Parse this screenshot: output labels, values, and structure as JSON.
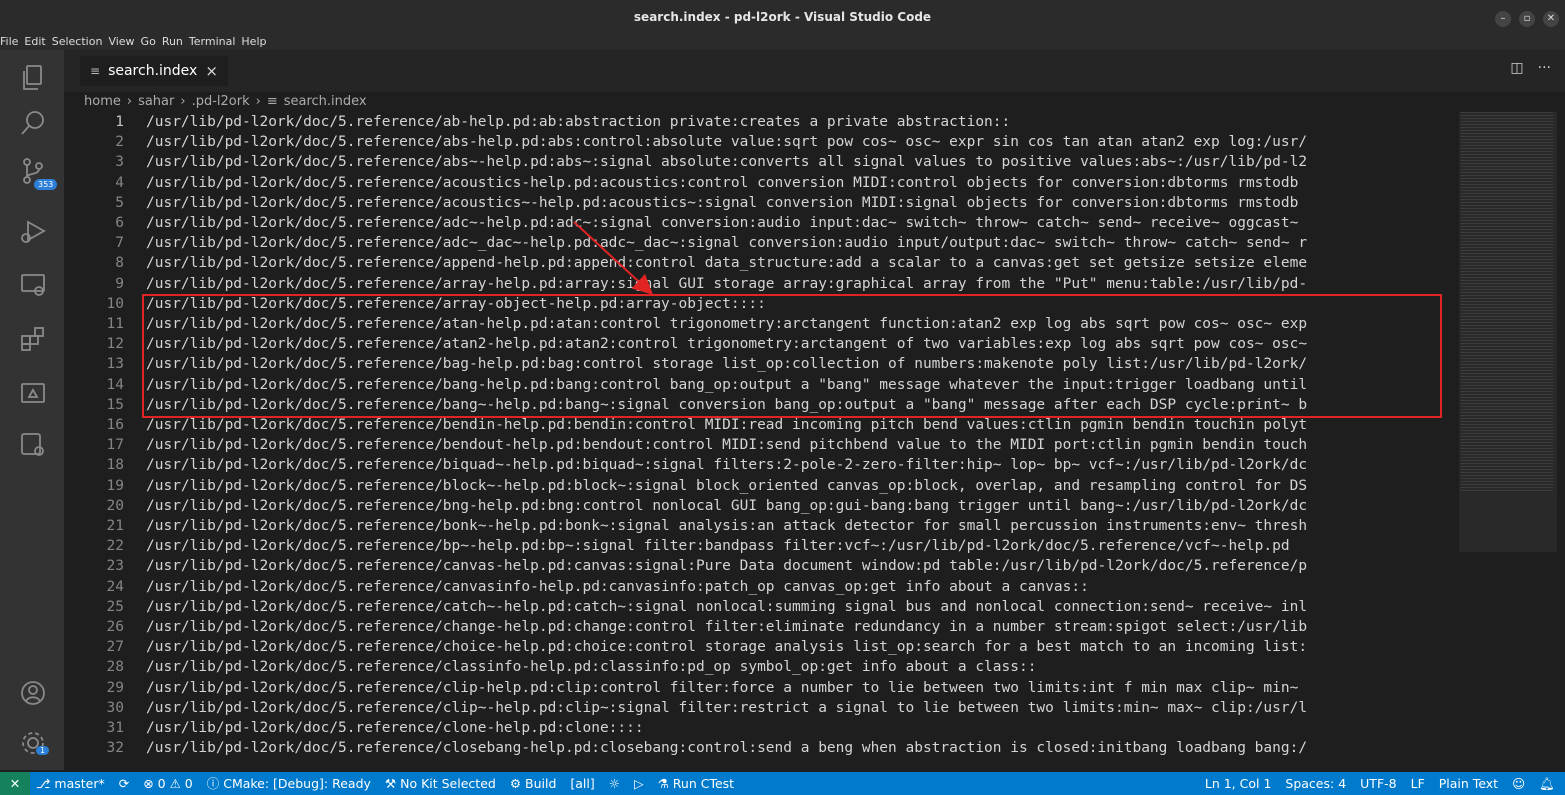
{
  "window": {
    "title": "search.index - pd-l2ork - Visual Studio Code"
  },
  "menu": [
    "File",
    "Edit",
    "Selection",
    "View",
    "Go",
    "Run",
    "Terminal",
    "Help"
  ],
  "activity_bar": {
    "scm_badge": "353",
    "manage_badge": "1"
  },
  "tab": {
    "label": "search.index",
    "close": "×"
  },
  "breadcrumb": [
    "home",
    "sahar",
    ".pd-l2ork",
    "search.index"
  ],
  "editor": {
    "lines": [
      {
        "n": "1",
        "text": "/usr/lib/pd-l2ork/doc/5.reference/ab-help.pd:ab:abstraction private:creates a private abstraction::"
      },
      {
        "n": "2",
        "text": "/usr/lib/pd-l2ork/doc/5.reference/abs-help.pd:abs:control:absolute value:sqrt pow cos~ osc~ expr sin cos tan atan atan2 exp log:/usr/"
      },
      {
        "n": "3",
        "text": "/usr/lib/pd-l2ork/doc/5.reference/abs~-help.pd:abs~:signal absolute:converts all signal values to positive values:abs~:/usr/lib/pd-l2"
      },
      {
        "n": "4",
        "text": "/usr/lib/pd-l2ork/doc/5.reference/acoustics-help.pd:acoustics:control conversion MIDI:control objects for conversion:dbtorms rmstodb"
      },
      {
        "n": "5",
        "text": "/usr/lib/pd-l2ork/doc/5.reference/acoustics~-help.pd:acoustics~:signal conversion MIDI:signal objects for conversion:dbtorms rmstodb"
      },
      {
        "n": "6",
        "text": "/usr/lib/pd-l2ork/doc/5.reference/adc~-help.pd:adc~:signal conversion:audio input:dac~ switch~ throw~ catch~ send~ receive~ oggcast~"
      },
      {
        "n": "7",
        "text": "/usr/lib/pd-l2ork/doc/5.reference/adc~_dac~-help.pd:adc~_dac~:signal conversion:audio input/output:dac~ switch~ throw~ catch~ send~ r"
      },
      {
        "n": "8",
        "text": "/usr/lib/pd-l2ork/doc/5.reference/append-help.pd:append:control data_structure:add a scalar to a canvas:get set getsize setsize eleme"
      },
      {
        "n": "9",
        "text": "/usr/lib/pd-l2ork/doc/5.reference/array-help.pd:array:signal GUI storage array:graphical array from the \"Put\" menu:table:/usr/lib/pd-"
      },
      {
        "n": "10",
        "text": "/usr/lib/pd-l2ork/doc/5.reference/array-object-help.pd:array-object::::"
      },
      {
        "n": "11",
        "text": "/usr/lib/pd-l2ork/doc/5.reference/atan-help.pd:atan:control trigonometry:arctangent function:atan2 exp log abs sqrt pow cos~ osc~ exp"
      },
      {
        "n": "12",
        "text": "/usr/lib/pd-l2ork/doc/5.reference/atan2-help.pd:atan2:control trigonometry:arctangent of two variables:exp log abs sqrt pow cos~ osc~"
      },
      {
        "n": "13",
        "text": "/usr/lib/pd-l2ork/doc/5.reference/bag-help.pd:bag:control storage list_op:collection of numbers:makenote poly list:/usr/lib/pd-l2ork/"
      },
      {
        "n": "14",
        "text": "/usr/lib/pd-l2ork/doc/5.reference/bang-help.pd:bang:control bang_op:output a \"bang\" message whatever the input:trigger loadbang until"
      },
      {
        "n": "15",
        "text": "/usr/lib/pd-l2ork/doc/5.reference/bang~-help.pd:bang~:signal conversion bang_op:output a \"bang\" message after each DSP cycle:print~ b"
      },
      {
        "n": "16",
        "text": "/usr/lib/pd-l2ork/doc/5.reference/bendin-help.pd:bendin:control MIDI:read incoming pitch bend values:ctlin pgmin bendin touchin polyt"
      },
      {
        "n": "17",
        "text": "/usr/lib/pd-l2ork/doc/5.reference/bendout-help.pd:bendout:control MIDI:send pitchbend value to the MIDI port:ctlin pgmin bendin touch"
      },
      {
        "n": "18",
        "text": "/usr/lib/pd-l2ork/doc/5.reference/biquad~-help.pd:biquad~:signal filters:2-pole-2-zero-filter:hip~ lop~ bp~ vcf~:/usr/lib/pd-l2ork/dc"
      },
      {
        "n": "19",
        "text": "/usr/lib/pd-l2ork/doc/5.reference/block~-help.pd:block~:signal block_oriented canvas_op:block, overlap, and resampling control for DS"
      },
      {
        "n": "20",
        "text": "/usr/lib/pd-l2ork/doc/5.reference/bng-help.pd:bng:control nonlocal GUI bang_op:gui-bang:bang trigger until bang~:/usr/lib/pd-l2ork/dc"
      },
      {
        "n": "21",
        "text": "/usr/lib/pd-l2ork/doc/5.reference/bonk~-help.pd:bonk~:signal analysis:an attack detector for small percussion instruments:env~ thresh"
      },
      {
        "n": "22",
        "text": "/usr/lib/pd-l2ork/doc/5.reference/bp~-help.pd:bp~:signal filter:bandpass filter:vcf~:/usr/lib/pd-l2ork/doc/5.reference/vcf~-help.pd"
      },
      {
        "n": "23",
        "text": "/usr/lib/pd-l2ork/doc/5.reference/canvas-help.pd:canvas:signal:Pure Data document window:pd table:/usr/lib/pd-l2ork/doc/5.reference/p"
      },
      {
        "n": "24",
        "text": "/usr/lib/pd-l2ork/doc/5.reference/canvasinfo-help.pd:canvasinfo:patch_op canvas_op:get info about a canvas::"
      },
      {
        "n": "25",
        "text": "/usr/lib/pd-l2ork/doc/5.reference/catch~-help.pd:catch~:signal nonlocal:summing signal bus and nonlocal connection:send~ receive~ inl"
      },
      {
        "n": "26",
        "text": "/usr/lib/pd-l2ork/doc/5.reference/change-help.pd:change:control filter:eliminate redundancy in a number stream:spigot select:/usr/lib"
      },
      {
        "n": "27",
        "text": "/usr/lib/pd-l2ork/doc/5.reference/choice-help.pd:choice:control storage analysis list_op:search for a best match to an incoming list:"
      },
      {
        "n": "28",
        "text": "/usr/lib/pd-l2ork/doc/5.reference/classinfo-help.pd:classinfo:pd_op symbol_op:get info about a class::"
      },
      {
        "n": "29",
        "text": "/usr/lib/pd-l2ork/doc/5.reference/clip-help.pd:clip:control filter:force a number to lie between two limits:int f min max clip~ min~"
      },
      {
        "n": "30",
        "text": "/usr/lib/pd-l2ork/doc/5.reference/clip~-help.pd:clip~:signal filter:restrict a signal to lie between two limits:min~ max~ clip:/usr/l"
      },
      {
        "n": "31",
        "text": "/usr/lib/pd-l2ork/doc/5.reference/clone-help.pd:clone::::"
      },
      {
        "n": "32",
        "text": "/usr/lib/pd-l2ork/doc/5.reference/closebang-help.pd:closebang:control:send a beng when abstraction is closed:initbang loadbang bang:/"
      }
    ]
  },
  "statusbar": {
    "branch": "master*",
    "problems": "⊗ 0 ⚠ 0",
    "cmake": "CMake: [Debug]: Ready",
    "kit": "No Kit Selected",
    "build": "Build",
    "target": "[all]",
    "run_ctest": "Run CTest",
    "position": "Ln 1, Col 1",
    "spaces": "Spaces: 4",
    "encoding": "UTF-8",
    "eol": "LF",
    "language": "Plain Text"
  }
}
